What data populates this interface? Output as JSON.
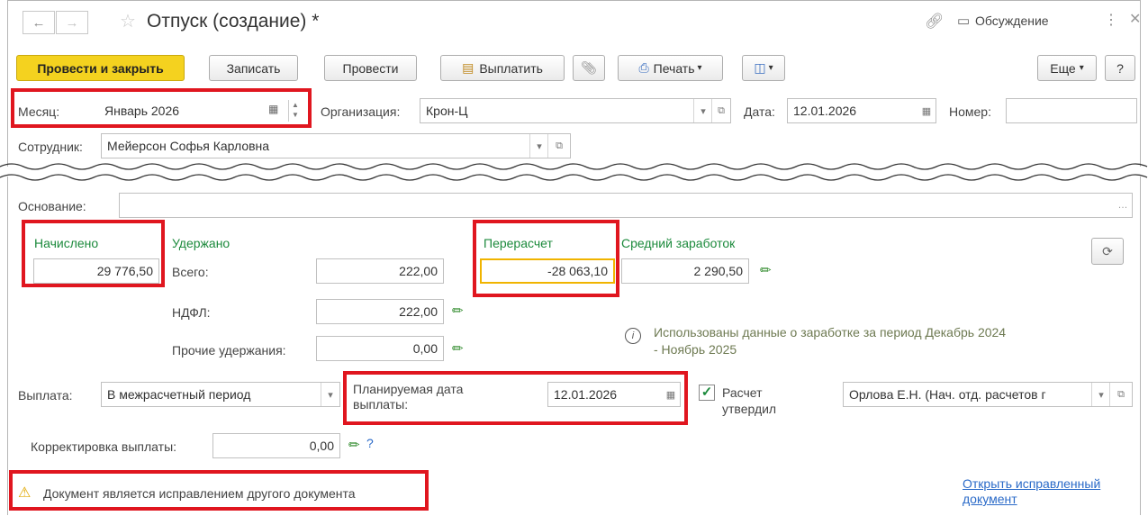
{
  "window": {
    "title": "Отпуск (создание) *",
    "discussion_label": "Обсуждение"
  },
  "toolbar": {
    "post_close": "Провести и закрыть",
    "save": "Записать",
    "post": "Провести",
    "pay": "Выплатить",
    "print": "Печать",
    "more": "Еще",
    "help": "?"
  },
  "header": {
    "month_label": "Месяц:",
    "month_value": "Январь 2026",
    "org_label": "Организация:",
    "org_value": "Крон-Ц",
    "date_label": "Дата:",
    "date_value": "12.01.2026",
    "number_label": "Номер:",
    "number_value": "",
    "employee_label": "Сотрудник:",
    "employee_value": "Мейерсон Софья Карловна"
  },
  "body": {
    "basis_label": "Основание:",
    "basis_value": "",
    "accrued_label": "Начислено",
    "accrued_value": "29 776,50",
    "withheld_label": "Удержано",
    "total_label": "Всего:",
    "total_value": "222,00",
    "ndfl_label": "НДФЛ:",
    "ndfl_value": "222,00",
    "other_label": "Прочие удержания:",
    "other_value": "0,00",
    "recalc_label": "Перерасчет",
    "recalc_value": "-28 063,10",
    "avg_label": "Средний заработок",
    "avg_value": "2 290,50",
    "info_line1": "Использованы данные о заработке за период Декабрь 2024",
    "info_line2": "- Ноябрь 2025",
    "payment_label": "Выплата:",
    "payment_value": "В межрасчетный период",
    "planned_label_1": "Планируемая дата",
    "planned_label_2": "выплаты:",
    "planned_value": "12.01.2026",
    "approved_label_1": "Расчет",
    "approved_label_2": "утвердил",
    "approver_value": "Орлова Е.Н. (Нач. отд. расчетов г",
    "correction_label": "Корректировка выплаты:",
    "correction_value": "0,00",
    "correction_help": "?",
    "warning_text": "Документ является исправлением другого документа",
    "open_link_1": "Открыть исправленный",
    "open_link_2": "документ"
  },
  "colors": {
    "highlight": "#e0161f",
    "primary_button": "#f4d21f",
    "accent_green": "#1c8a3c",
    "link": "#2a6ac8"
  }
}
